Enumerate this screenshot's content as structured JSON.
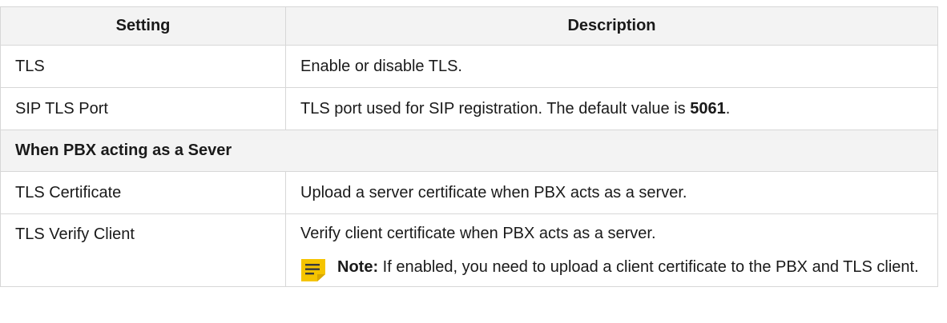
{
  "table": {
    "headers": [
      "Setting",
      "Description"
    ],
    "rows": [
      {
        "setting": "TLS",
        "description": "Enable or disable TLS."
      },
      {
        "setting": "SIP TLS Port",
        "description_pre": "TLS port used for SIP registration. The default value is ",
        "description_bold": "5061",
        "description_post": "."
      }
    ],
    "section": "When PBX acting as a Sever",
    "rows2": [
      {
        "setting": "TLS Certificate",
        "description": "Upload a server certificate when PBX acts as a server."
      },
      {
        "setting": "TLS Verify Client",
        "description": "Verify client certificate when PBX acts as a server.",
        "note_label": "Note:",
        "note_text": "If enabled, you need to upload a client certificate to the PBX and TLS client."
      }
    ]
  },
  "colors": {
    "note_icon": "#f5c400",
    "header_bg": "#f3f3f3",
    "border": "#d7d7d7"
  },
  "icons": {
    "note": "note-icon"
  }
}
